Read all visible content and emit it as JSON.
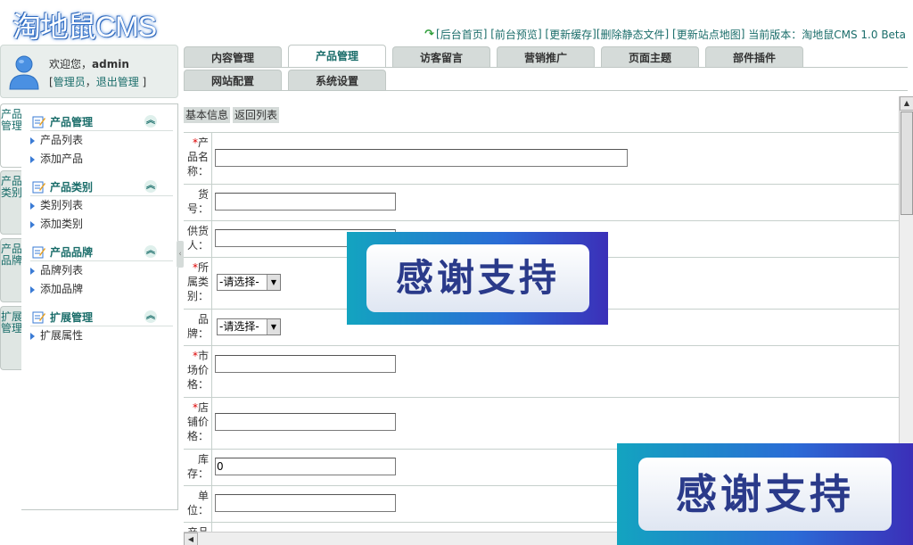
{
  "app": {
    "logo": "淘地鼠CMS"
  },
  "topbar": {
    "links": [
      "后台首页",
      "前台预览",
      "更新缓存",
      "删除静态文件",
      "更新站点地图"
    ],
    "version_label": "当前版本：",
    "version": "淘地鼠CMS 1.0 Beta"
  },
  "user": {
    "welcome": "欢迎您，",
    "name": "admin",
    "role": "管理员",
    "logout": "退出管理"
  },
  "tabs": [
    "内容管理",
    "产品管理",
    "访客留言",
    "营销推广",
    "页面主题",
    "部件插件",
    "网站配置",
    "系统设置"
  ],
  "active_tab": "产品管理",
  "side_tabs": [
    "产品管理",
    "产品类别",
    "产品品牌",
    "扩展管理"
  ],
  "menu": [
    {
      "title": "产品管理",
      "items": [
        "产品列表",
        "添加产品"
      ]
    },
    {
      "title": "产品类别",
      "items": [
        "类别列表",
        "添加类别"
      ]
    },
    {
      "title": "产品品牌",
      "items": [
        "品牌列表",
        "添加品牌"
      ]
    },
    {
      "title": "扩展管理",
      "items": [
        "扩展属性"
      ]
    }
  ],
  "subtabs": [
    "基本信息",
    "返回列表"
  ],
  "form": {
    "product_name": {
      "label": "产品名称：",
      "required": true,
      "value": ""
    },
    "sku": {
      "label": "货号：",
      "required": false,
      "value": ""
    },
    "supplier": {
      "label": "供货人：",
      "required": false,
      "value": ""
    },
    "category": {
      "label": "所属类别：",
      "required": true,
      "value": "-请选择-"
    },
    "brand": {
      "label": "品牌：",
      "required": false,
      "value": "-请选择-"
    },
    "market_price": {
      "label": "市场价格：",
      "required": true,
      "value": ""
    },
    "shop_price": {
      "label": "店铺价格：",
      "required": true,
      "value": ""
    },
    "stock": {
      "label": "库存：",
      "required": false,
      "value": "0"
    },
    "unit": {
      "label": "单位：",
      "required": false,
      "value": ""
    },
    "next_label": "产品"
  },
  "watermark": {
    "text": "感谢支持"
  },
  "colors": {
    "accent": "#1a6d6a",
    "required": "#dd0000",
    "tab_bg": "#d5dbd9"
  }
}
